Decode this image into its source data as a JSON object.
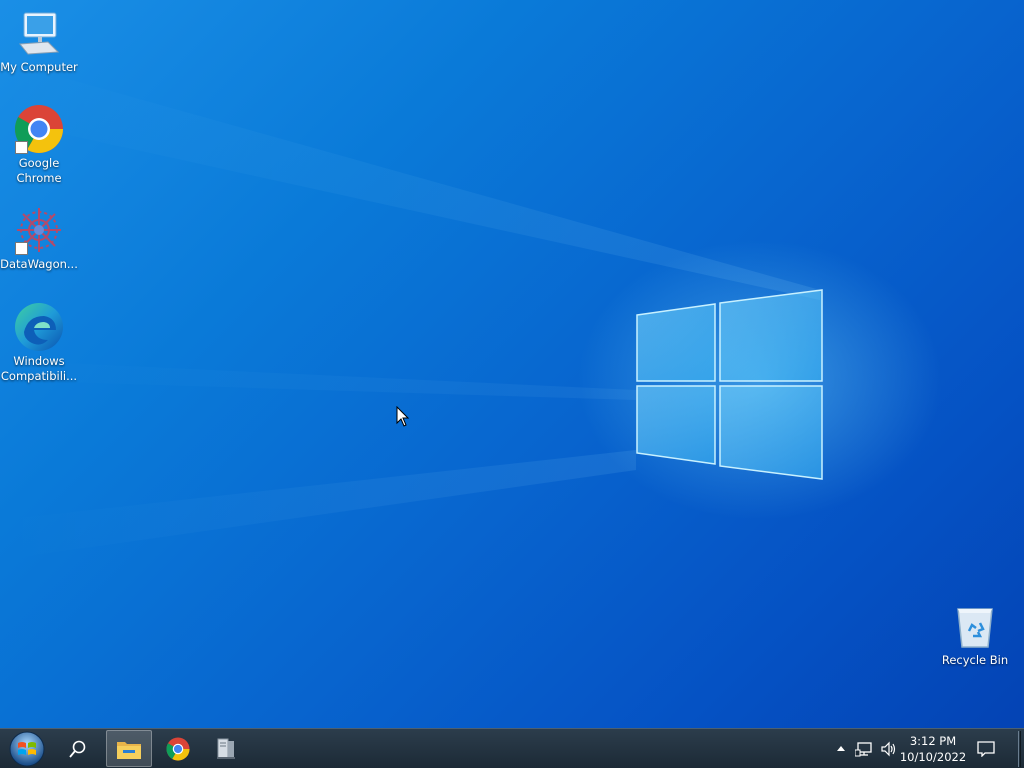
{
  "desktop": {
    "icons": [
      {
        "label": "My Computer",
        "icon": "computer-icon"
      },
      {
        "label": "Google Chrome",
        "icon": "chrome-icon"
      },
      {
        "label": "DataWagon...",
        "icon": "datawagon-icon"
      },
      {
        "label": "Windows Compatibili...",
        "icon": "edge-icon"
      },
      {
        "label": "Recycle Bin",
        "icon": "recycle-bin-icon"
      }
    ]
  },
  "taskbar": {
    "pinned": [
      {
        "icon": "start-orb-icon"
      },
      {
        "icon": "search-icon"
      },
      {
        "icon": "file-explorer-icon",
        "active": true
      },
      {
        "icon": "chrome-icon"
      },
      {
        "icon": "server-manager-icon"
      }
    ],
    "tray": {
      "icons": [
        "show-hidden-icons-chevron",
        "network-icon",
        "volume-icon"
      ],
      "time": "3:12 PM",
      "date": "10/10/2022",
      "notification_icon": "action-center-icon"
    }
  },
  "colors": {
    "desktop_blue": "#0a7ad8",
    "taskbar": "#1c2a36"
  }
}
